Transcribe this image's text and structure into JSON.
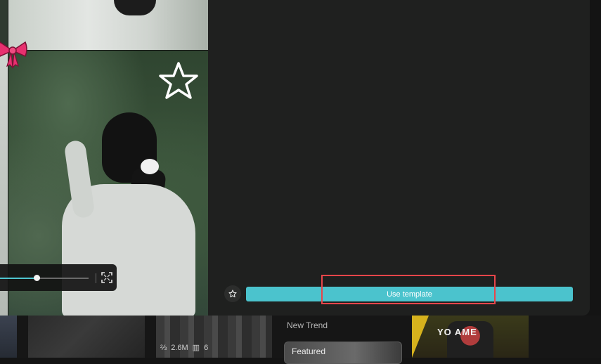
{
  "template_modal": {
    "use_template_label": "Use template",
    "favorite_icon": "star-outline-icon",
    "player": {
      "progress_fraction": 0.41,
      "fullscreen_icon": "fullscreen-icon"
    },
    "decorations": [
      "star-icon",
      "bow-icon"
    ]
  },
  "gallery": {
    "section_label": "New Trend",
    "featured_label": "Featured",
    "card_stats": {
      "uses": "2.6M",
      "clips": "6"
    },
    "card_text": "YO  AME"
  },
  "colors": {
    "accent": "#4bc3cd",
    "highlight": "#e8454a",
    "panel": "#1f201f"
  }
}
